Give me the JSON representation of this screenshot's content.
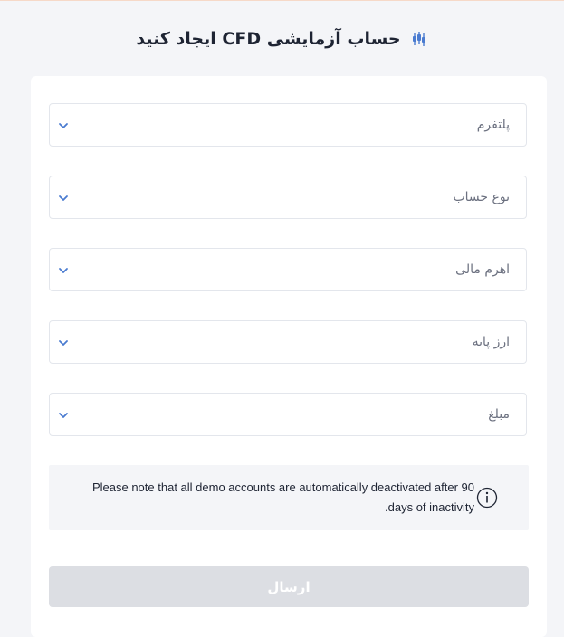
{
  "header": {
    "title": "حساب آزمایشی CFD ایجاد کنید",
    "icon": "candlestick-icon"
  },
  "form": {
    "fields": [
      {
        "label": "پلتفرم"
      },
      {
        "label": "نوع حساب"
      },
      {
        "label": "اهرم مالی"
      },
      {
        "label": "ارز پایه"
      },
      {
        "label": "مبلغ"
      }
    ],
    "notice": "Please note that all demo accounts are automatically deactivated after 90 days of inactivity.",
    "submit_label": "ارسال"
  },
  "colors": {
    "accent": "#4a7bd0",
    "page_bg": "#f4f5f8",
    "submit_disabled": "#dcdee3"
  }
}
